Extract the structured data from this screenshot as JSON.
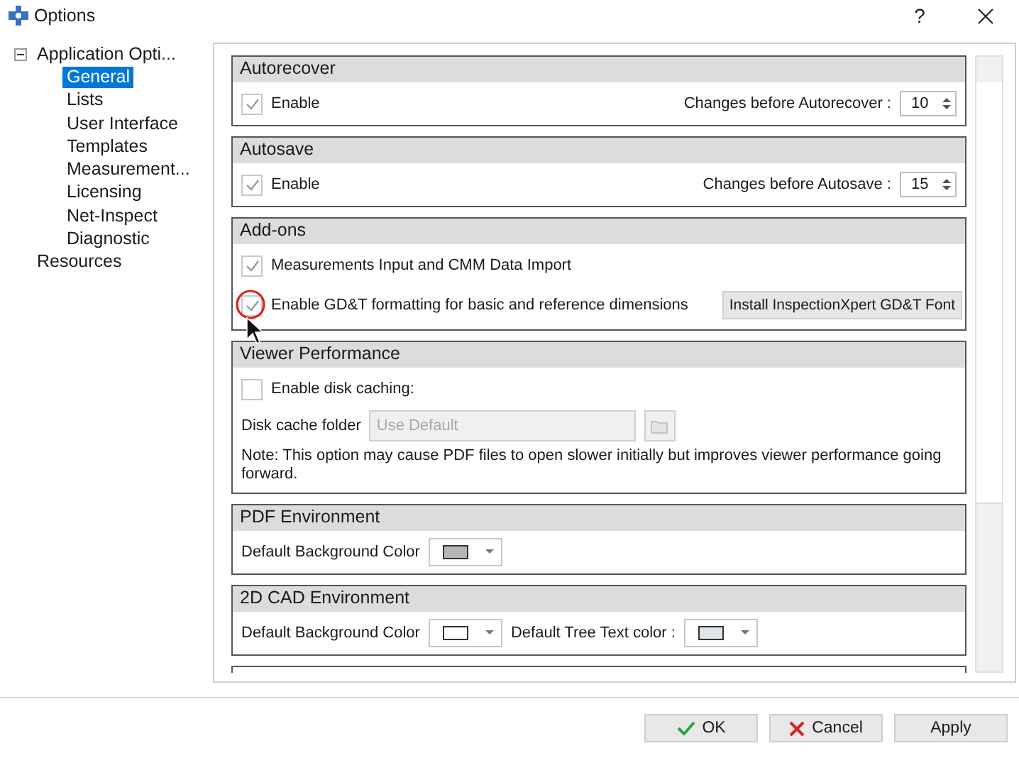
{
  "window": {
    "title": "Options",
    "help": "?"
  },
  "tree": [
    {
      "label": "Application Opti...",
      "expanded": true,
      "selected": false,
      "children": [
        {
          "label": "General",
          "selected": true
        },
        {
          "label": "Lists",
          "selected": false
        },
        {
          "label": "User Interface",
          "selected": false
        },
        {
          "label": "Templates",
          "selected": false
        },
        {
          "label": "Measurement...",
          "selected": false
        },
        {
          "label": "Licensing",
          "selected": false
        },
        {
          "label": "Net-Inspect",
          "selected": false
        },
        {
          "label": "Diagnostic",
          "selected": false
        }
      ]
    },
    {
      "label": "Resources",
      "selected": false
    }
  ],
  "sections": [
    {
      "title": "Autorecover",
      "rows": [
        {
          "kind": "checkbox_spin",
          "label": "Enable",
          "checked": true,
          "spin_label": "Changes before Autorecover :",
          "spin_value": "10"
        }
      ]
    },
    {
      "title": "Autosave",
      "rows": [
        {
          "kind": "checkbox_spin",
          "label": "Enable",
          "checked": true,
          "spin_label": "Changes before Autosave :",
          "spin_value": "15"
        }
      ]
    },
    {
      "title": "Add-ons",
      "rows": [
        {
          "kind": "checkbox",
          "label": "Measurements Input and CMM Data Import",
          "checked": true,
          "annotated": false
        },
        {
          "kind": "checkbox",
          "label": "Enable GD&T formatting for basic and reference dimensions",
          "checked": true,
          "annotated": true,
          "button": "Install InspectionXpert GD&T Font"
        }
      ]
    },
    {
      "title": "Viewer Performance",
      "rows": [
        {
          "kind": "checkbox",
          "label": "Enable disk caching:",
          "checked": false,
          "annotated": false
        },
        {
          "kind": "folder",
          "label": "Disk cache folder",
          "placeholder": "Use Default",
          "disabled": true
        },
        {
          "kind": "note",
          "text": "Note: This option may cause PDF files to open slower initially but improves viewer performance going forward."
        }
      ]
    },
    {
      "title": "PDF Environment",
      "rows": [
        {
          "kind": "colors",
          "pickers": [
            {
              "label": "Default Background Color",
              "color": "#b4b4b4"
            }
          ]
        }
      ]
    },
    {
      "title": "2D CAD Environment",
      "rows": [
        {
          "kind": "colors",
          "pickers": [
            {
              "label": "Default Background Color",
              "color": "#ffffff"
            },
            {
              "label": "Default Tree Text color :",
              "color": "#dde3e8"
            }
          ]
        }
      ]
    }
  ],
  "footer_buttons": [
    {
      "label": "OK",
      "kind": "ok"
    },
    {
      "label": "Cancel",
      "kind": "cancel"
    },
    {
      "label": "Apply",
      "kind": "apply"
    }
  ]
}
